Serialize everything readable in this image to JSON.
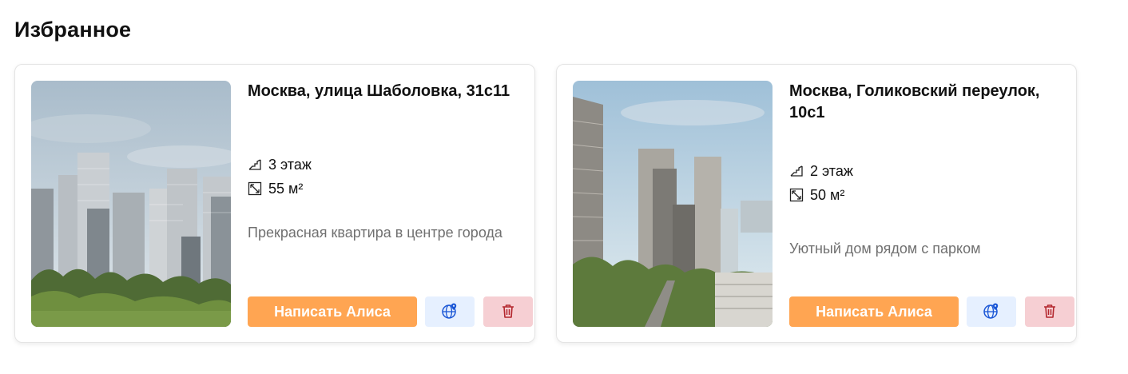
{
  "page": {
    "title": "Избранное"
  },
  "cards": [
    {
      "address": "Москва, улица Шаболовка, 31с11",
      "floor": "3 этаж",
      "area": "55 м²",
      "description": "Прекрасная квартира в центре города",
      "write_label": "Написать Алиса",
      "icons": {
        "floor": "stairs-icon",
        "area": "area-resize-icon",
        "map": "globe-pin-icon",
        "delete": "trash-icon"
      }
    },
    {
      "address": "Москва, Голиковский переулок, 10с1",
      "floor": "2 этаж",
      "area": "50 м²",
      "description": "Уютный дом рядом с парком",
      "write_label": "Написать Алиса",
      "icons": {
        "floor": "stairs-icon",
        "area": "area-resize-icon",
        "map": "globe-pin-icon",
        "delete": "trash-icon"
      }
    }
  ],
  "colors": {
    "accent": "#ffa552",
    "map_button_bg": "#e6f0ff",
    "delete_button_bg": "#f6cfd3",
    "map_icon": "#1a56d6",
    "delete_icon": "#b3262d",
    "muted_text": "#707070"
  }
}
